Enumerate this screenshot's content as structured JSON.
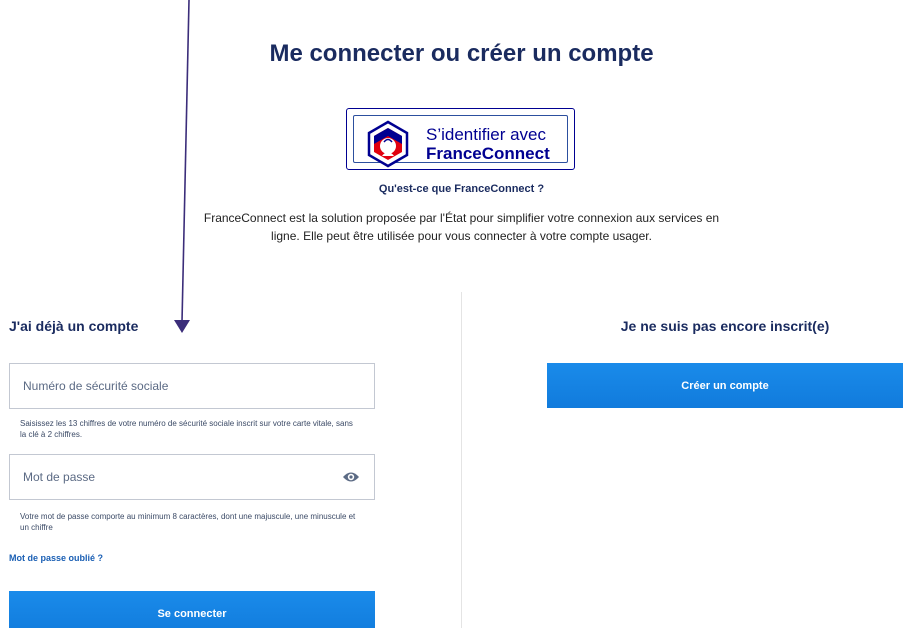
{
  "header": {
    "title": "Me connecter ou créer un compte"
  },
  "franceconnect": {
    "button_line1": "S’identifier avec",
    "button_line2": "FranceConnect",
    "what_is_link": "Qu'est-ce que FranceConnect ?",
    "description": "FranceConnect est la solution proposée par l'État pour simplifier votre connexion aux services en ligne. Elle peut être utilisée pour vous connecter à votre compte usager."
  },
  "login": {
    "title": "J'ai déjà un compte",
    "ssn_placeholder": "Numéro de sécurité sociale",
    "ssn_hint": "Saisissez les 13 chiffres de votre numéro de sécurité sociale inscrit sur votre carte vitale, sans la clé à 2 chiffres.",
    "password_placeholder": "Mot de passe",
    "password_hint": "Votre mot de passe comporte au minimum 8 caractères, dont une majuscule, une minuscule et un chiffre",
    "forgot_password": "Mot de passe oublié ?",
    "submit_label": "Se connecter"
  },
  "register": {
    "title": "Je ne suis pas encore inscrit(e)",
    "create_label": "Créer un compte"
  },
  "icons": {
    "franceconnect_logo": "franceconnect-logo-icon",
    "show_password": "eye-icon",
    "annotation": "arrow-down-icon"
  },
  "colors": {
    "title": "#1a2b5f",
    "franceconnect_blue": "#000091",
    "primary_button": "#1585e3",
    "link": "#1a5fb4",
    "annotation_arrow": "#3b2d7a"
  }
}
